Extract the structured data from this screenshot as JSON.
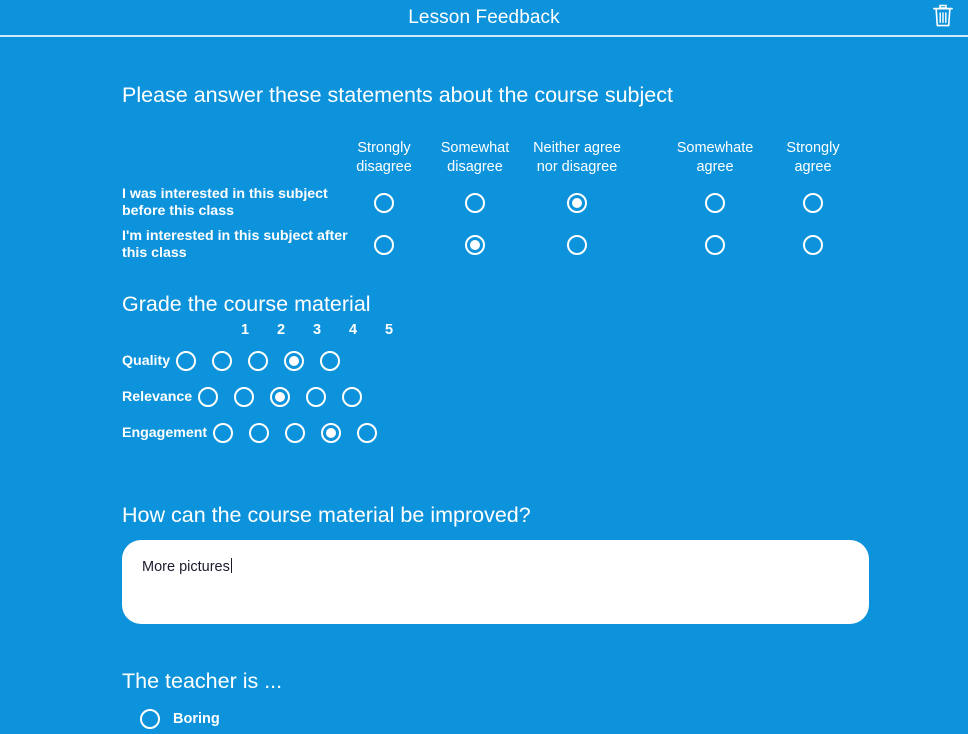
{
  "header": {
    "title": "Lesson Feedback",
    "delete_icon": "trash-icon"
  },
  "sections": {
    "statements": {
      "title": "Please answer these statements about the course subject",
      "columns": [
        {
          "line1": "Strongly",
          "line2": "disagree"
        },
        {
          "line1": "Somewhat",
          "line2": "disagree"
        },
        {
          "line1": "Neither agree",
          "line2": "nor disagree"
        },
        {
          "line1": "Somewhate",
          "line2": "agree"
        },
        {
          "line1": "Strongly",
          "line2": "agree"
        }
      ],
      "rows": [
        {
          "label": "I was interested in this subject before this class",
          "selected": 2
        },
        {
          "label": "I'm interested in this subject after this class",
          "selected": 1
        }
      ]
    },
    "grade": {
      "title": "Grade the course material",
      "scale": [
        "1",
        "2",
        "3",
        "4",
        "5"
      ],
      "rows": [
        {
          "label": "Quality",
          "selected": 3
        },
        {
          "label": "Relevance",
          "selected": 2
        },
        {
          "label": "Engagement",
          "selected": 3
        }
      ]
    },
    "improve": {
      "title": "How can the course material be improved?",
      "value": "More pictures",
      "placeholder": ""
    },
    "teacher": {
      "title": "The teacher is ...",
      "options": [
        {
          "label": "Boring",
          "selected": false
        }
      ]
    }
  },
  "colors": {
    "background": "#0d93db",
    "foreground": "#ffffff",
    "field_background": "#ffffff",
    "field_text": "#1a1a2e",
    "header_rule": "#cfe9f8"
  }
}
